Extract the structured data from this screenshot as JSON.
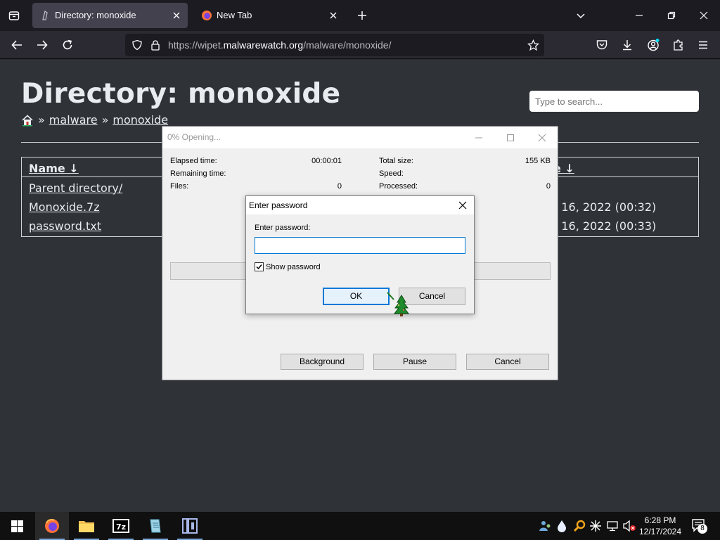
{
  "browser": {
    "tabs": [
      {
        "title": "Directory: monoxide",
        "active": true
      },
      {
        "title": "New Tab",
        "active": false
      }
    ],
    "url": {
      "prefix": "https://wipet.",
      "host": "malwarewatch.org",
      "path": "/malware/monoxide/"
    }
  },
  "page": {
    "title": "Directory: monoxide",
    "search_placeholder": "Type to search...",
    "breadcrumb": {
      "home_icon": "home-icon",
      "sep": "»",
      "items": [
        "malware",
        "monoxide"
      ]
    },
    "table": {
      "col_name": "Name ↓",
      "col_date_visible": "e ↓",
      "rows": [
        {
          "name": "Parent directory/",
          "date_visible": ""
        },
        {
          "name": "Monoxide.7z",
          "date_visible": ") 16, 2022 (00:32)"
        },
        {
          "name": "password.txt",
          "date_visible": ") 16, 2022 (00:33)"
        }
      ]
    }
  },
  "progress_window": {
    "title": "0% Opening...",
    "left_stats": [
      {
        "label": "Elapsed time:",
        "value": "00:00:01"
      },
      {
        "label": "Remaining time:",
        "value": ""
      },
      {
        "label": "Files:",
        "value": "0"
      }
    ],
    "right_stats": [
      {
        "label": "Total size:",
        "value": "155 KB"
      },
      {
        "label": "Speed:",
        "value": ""
      },
      {
        "label": "Processed:",
        "value": "0"
      }
    ],
    "progress_percent": 0,
    "buttons": {
      "background": "Background",
      "pause": "Pause",
      "cancel": "Cancel"
    }
  },
  "password_dialog": {
    "title": "Enter password",
    "label": "Enter password:",
    "value": "",
    "show_password_label": "Show password",
    "show_password_checked": true,
    "ok": "OK",
    "cancel": "Cancel"
  },
  "taskbar": {
    "apps": [
      "firefox-icon",
      "file-explorer-icon",
      "7zip-icon",
      "notepad-icon",
      "app-icon"
    ],
    "clock": {
      "time": "6:28 PM",
      "date": "12/17/2024"
    },
    "notifications_count": "8"
  },
  "colors": {
    "page_bg": "#2f3338",
    "tab_bg": "#1c1b22",
    "accent_blue": "#0078d7"
  }
}
